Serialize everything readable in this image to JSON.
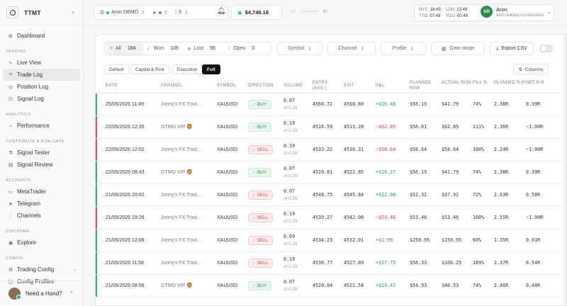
{
  "app": {
    "title": "TTMT"
  },
  "sidebar": {
    "sections": [
      {
        "label": "",
        "items": [
          {
            "label": "Dashboard",
            "icon": "grid-icon"
          }
        ]
      },
      {
        "label": "TRADING",
        "items": [
          {
            "label": "Live View",
            "icon": "pulse-icon"
          },
          {
            "label": "Trade Log",
            "icon": "list-icon",
            "active": true
          },
          {
            "label": "Position Log",
            "icon": "target-icon"
          },
          {
            "label": "Signal Log",
            "icon": "signal-icon"
          }
        ]
      },
      {
        "label": "ANALYTICS",
        "items": [
          {
            "label": "Performance",
            "icon": "chart-icon"
          }
        ]
      },
      {
        "label": "CONTRIBUTE & EVALUATE",
        "items": [
          {
            "label": "Signal Tester",
            "icon": "flask-icon"
          },
          {
            "label": "Signal Review",
            "icon": "clipboard-icon"
          }
        ]
      },
      {
        "label": "ACCOUNTS",
        "items": [
          {
            "label": "MetaTrader",
            "icon": "monitor-icon"
          },
          {
            "label": "Telegram",
            "icon": "send-icon"
          },
          {
            "label": "Channels",
            "icon": "channels-icon"
          }
        ]
      },
      {
        "label": "DISCOVER",
        "items": [
          {
            "label": "Explore",
            "icon": "compass-icon"
          }
        ]
      },
      {
        "label": "CONFIG",
        "items": [
          {
            "label": "Trading Config",
            "icon": "gear-icon",
            "chevron": true
          },
          {
            "label": "Config Profiles",
            "icon": "layers-icon"
          }
        ]
      }
    ],
    "help_label": "Need a Hand?"
  },
  "topbar": {
    "account": "Aron DEMO",
    "filter_count": "5",
    "balance": "$4,748.18",
    "equity_small": "$0",
    "clocks": [
      {
        "c1": "NYC",
        "c2": "TYO",
        "t1": "18:49",
        "t2": "07:49"
      },
      {
        "c1": "LON",
        "c2": "YOU",
        "t1": "23:49",
        "t2": "00:49"
      }
    ],
    "user": {
      "initials": "AR",
      "name": "Aron",
      "handle": "aron.lukacs+production"
    }
  },
  "filters": {
    "outcomes": [
      {
        "label": "All",
        "count": "184"
      },
      {
        "label": "Won",
        "count": "106"
      },
      {
        "label": "Lost",
        "count": "55"
      },
      {
        "label": "Open",
        "count": "0"
      }
    ],
    "dropdowns": [
      "Symbol",
      "Channel",
      "Profile"
    ],
    "date_range": "Date range",
    "export": "Export CSV"
  },
  "views": [
    "Default",
    "Capital & Risk",
    "Execution",
    "Full"
  ],
  "columns_label": "Columns",
  "table": {
    "headers": [
      "DATE",
      "CHANNEL",
      "SYMBOL",
      "DIRECTION",
      "VOLUME",
      "ENTRY (AVG.)",
      "EXIT",
      "P&L",
      "PLANNED RISK",
      "ACTUAL RISK",
      "FILL %",
      "PLANNED R:R",
      "NET R:R"
    ],
    "rows": [
      {
        "date": "25/05/2026 11:49",
        "channel": "Jonny's FX Trad...",
        "symbol": "XAUUSD",
        "dir": "BUY",
        "vol": "0.07",
        "vol2": "of 0.19",
        "entry": "4566.72",
        "exit": "4568.80",
        "pnl": "+$16.48",
        "prisk": "$56.19",
        "arisk": "$41.79",
        "fill": "74%",
        "prr": "2.38R",
        "nrr": "0.39R",
        "win": true
      },
      {
        "date": "22/05/2026 12:35",
        "channel": "GTMO VIP 🦁",
        "symbol": "XAUUSD",
        "dir": "BUY",
        "vol": "0.19",
        "vol2": "of 0.19",
        "entry": "4516.59",
        "exit": "4513.28",
        "pnl": "−$62.85",
        "prisk": "$56.61",
        "arisk": "$62.85",
        "fill": "111%",
        "prr": "2.36R",
        "nrr": "−1.00R",
        "win": false
      },
      {
        "date": "22/05/2026 12:02",
        "channel": "Jonny's FX Trad...",
        "symbol": "XAUUSD",
        "dir": "SELL",
        "vol": "0.19",
        "vol2": "of 0.19",
        "entry": "4533.22",
        "exit": "4536.31",
        "pnl": "−$58.64",
        "prisk": "$58.64",
        "arisk": "$58.64",
        "fill": "100%",
        "prr": "2.24R",
        "nrr": "−1.00R",
        "win": false
      },
      {
        "date": "22/05/2026 09:43",
        "channel": "GTMO VIP 🦁",
        "symbol": "XAUUSD",
        "dir": "BUY",
        "vol": "0.07",
        "vol2": "of 0.19",
        "entry": "4520.81",
        "exit": "4522.85",
        "pnl": "+$16.27",
        "prisk": "$56.19",
        "arisk": "$41.79",
        "fill": "74%",
        "prr": "2.38R",
        "nrr": "0.39R",
        "win": true
      },
      {
        "date": "21/05/2026 20:02",
        "channel": "Jonny's FX Trad...",
        "symbol": "XAUUSD",
        "dir": "SELL",
        "vol": "0.07",
        "vol2": "of 0.19",
        "entry": "4548.75",
        "exit": "4545.84",
        "pnl": "+$22.08",
        "prisk": "$52.32",
        "arisk": "$37.92",
        "fill": "72%",
        "prr": "2.63R",
        "nrr": "0.58R",
        "win": true
      },
      {
        "date": "21/05/2026 19:26",
        "channel": "Jonny's FX Trad...",
        "symbol": "XAUUSD",
        "dir": "SELL",
        "vol": "0.19",
        "vol2": "of 0.19",
        "entry": "4539.27",
        "exit": "4542.08",
        "pnl": "−$53.46",
        "prisk": "$53.46",
        "arisk": "$53.46",
        "fill": "100%",
        "prr": "2.55R",
        "nrr": "−1.00R",
        "win": false
      },
      {
        "date": "21/05/2026 12:06",
        "channel": "Jonny's FX Trad...",
        "symbol": "XAUUSD",
        "dir": "SELL",
        "vol": "0.09",
        "vol2": "of 0.19",
        "entry": "4534.23",
        "exit": "4532.01",
        "pnl": "+$1.99",
        "prisk": "$250.95",
        "arisk": "$150.95",
        "fill": "60%",
        "prr": "1.35R",
        "nrr": "0.01R",
        "win": true
      },
      {
        "date": "21/05/2026 11:58",
        "channel": "Jonny's FX Trad...",
        "symbol": "XAUUSD",
        "dir": "SELL",
        "vol": "0.19",
        "vol2": "of 0.19",
        "entry": "4530.77",
        "exit": "4527.89",
        "pnl": "+$57.75",
        "prisk": "$56.33",
        "arisk": "$106.25",
        "fill": "189%",
        "prr": "2.37R",
        "nrr": "0.54R",
        "win": true
      },
      {
        "date": "21/05/2026 08:56",
        "channel": "GTMO VIP 🦁",
        "symbol": "XAUUSD",
        "dir": "BUY",
        "vol": "0.07",
        "vol2": "of 0.19",
        "entry": "4520.04",
        "exit": "4522.58",
        "pnl": "+$19.47",
        "prisk": "$54.93",
        "arisk": "$40.53",
        "fill": "74%",
        "prr": "2.46R",
        "nrr": "0.48R",
        "win": true
      }
    ]
  },
  "colors": {
    "win": "#2fb56a",
    "loss": "#e05252",
    "accent": "#111111"
  }
}
